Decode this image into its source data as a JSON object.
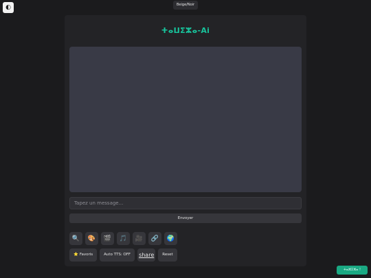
{
  "topbar": {
    "corner_icon": "moon-icon",
    "theme_toggle_label": "Beige/Noir"
  },
  "app": {
    "title": "ⵜⴰⵡⵉⵣⴰ-Ai"
  },
  "composer": {
    "placeholder": "Tapez un message...",
    "send_label": "Envoyer"
  },
  "tools": [
    {
      "icon": "🔍",
      "name": "search-icon"
    },
    {
      "icon": "🎨",
      "name": "palette-icon"
    },
    {
      "icon": "🎬",
      "name": "clapper-icon"
    },
    {
      "icon": "🎵",
      "name": "music-icon"
    },
    {
      "icon": "🎥",
      "name": "video-camera-icon"
    },
    {
      "icon": "🔗",
      "name": "link-icon"
    },
    {
      "icon": "🌍",
      "name": "globe-icon"
    }
  ],
  "actions": {
    "favoris_label": "Favoris",
    "tts_label": "Auto TTS: OFF",
    "share_label": "share",
    "reset_label": "Reset"
  },
  "status_badge": "ⵜⴰⵣⵉⵣⴰ !"
}
